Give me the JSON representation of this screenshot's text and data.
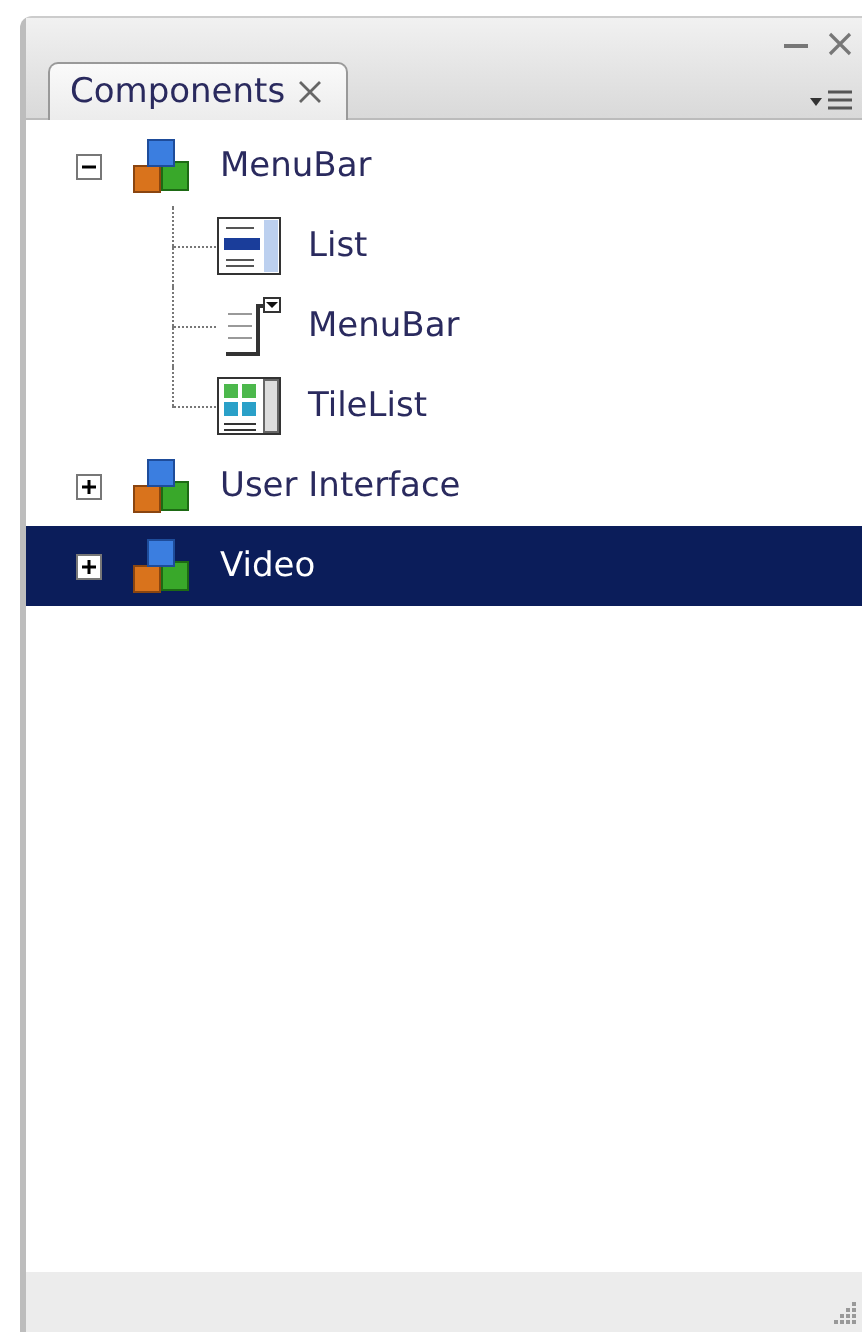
{
  "panel": {
    "tab": {
      "label": "Components",
      "selected": true
    }
  },
  "tree": [
    {
      "label": "MenuBar",
      "kind": "package",
      "expanded": true,
      "selected": false,
      "children": [
        {
          "label": "List",
          "kind": "list",
          "selected": false
        },
        {
          "label": "MenuBar",
          "kind": "menubar",
          "selected": false
        },
        {
          "label": "TileList",
          "kind": "tilelist",
          "selected": false
        }
      ]
    },
    {
      "label": "User Interface",
      "kind": "package",
      "expanded": false,
      "selected": false
    },
    {
      "label": "Video",
      "kind": "package",
      "expanded": false,
      "selected": true
    }
  ]
}
